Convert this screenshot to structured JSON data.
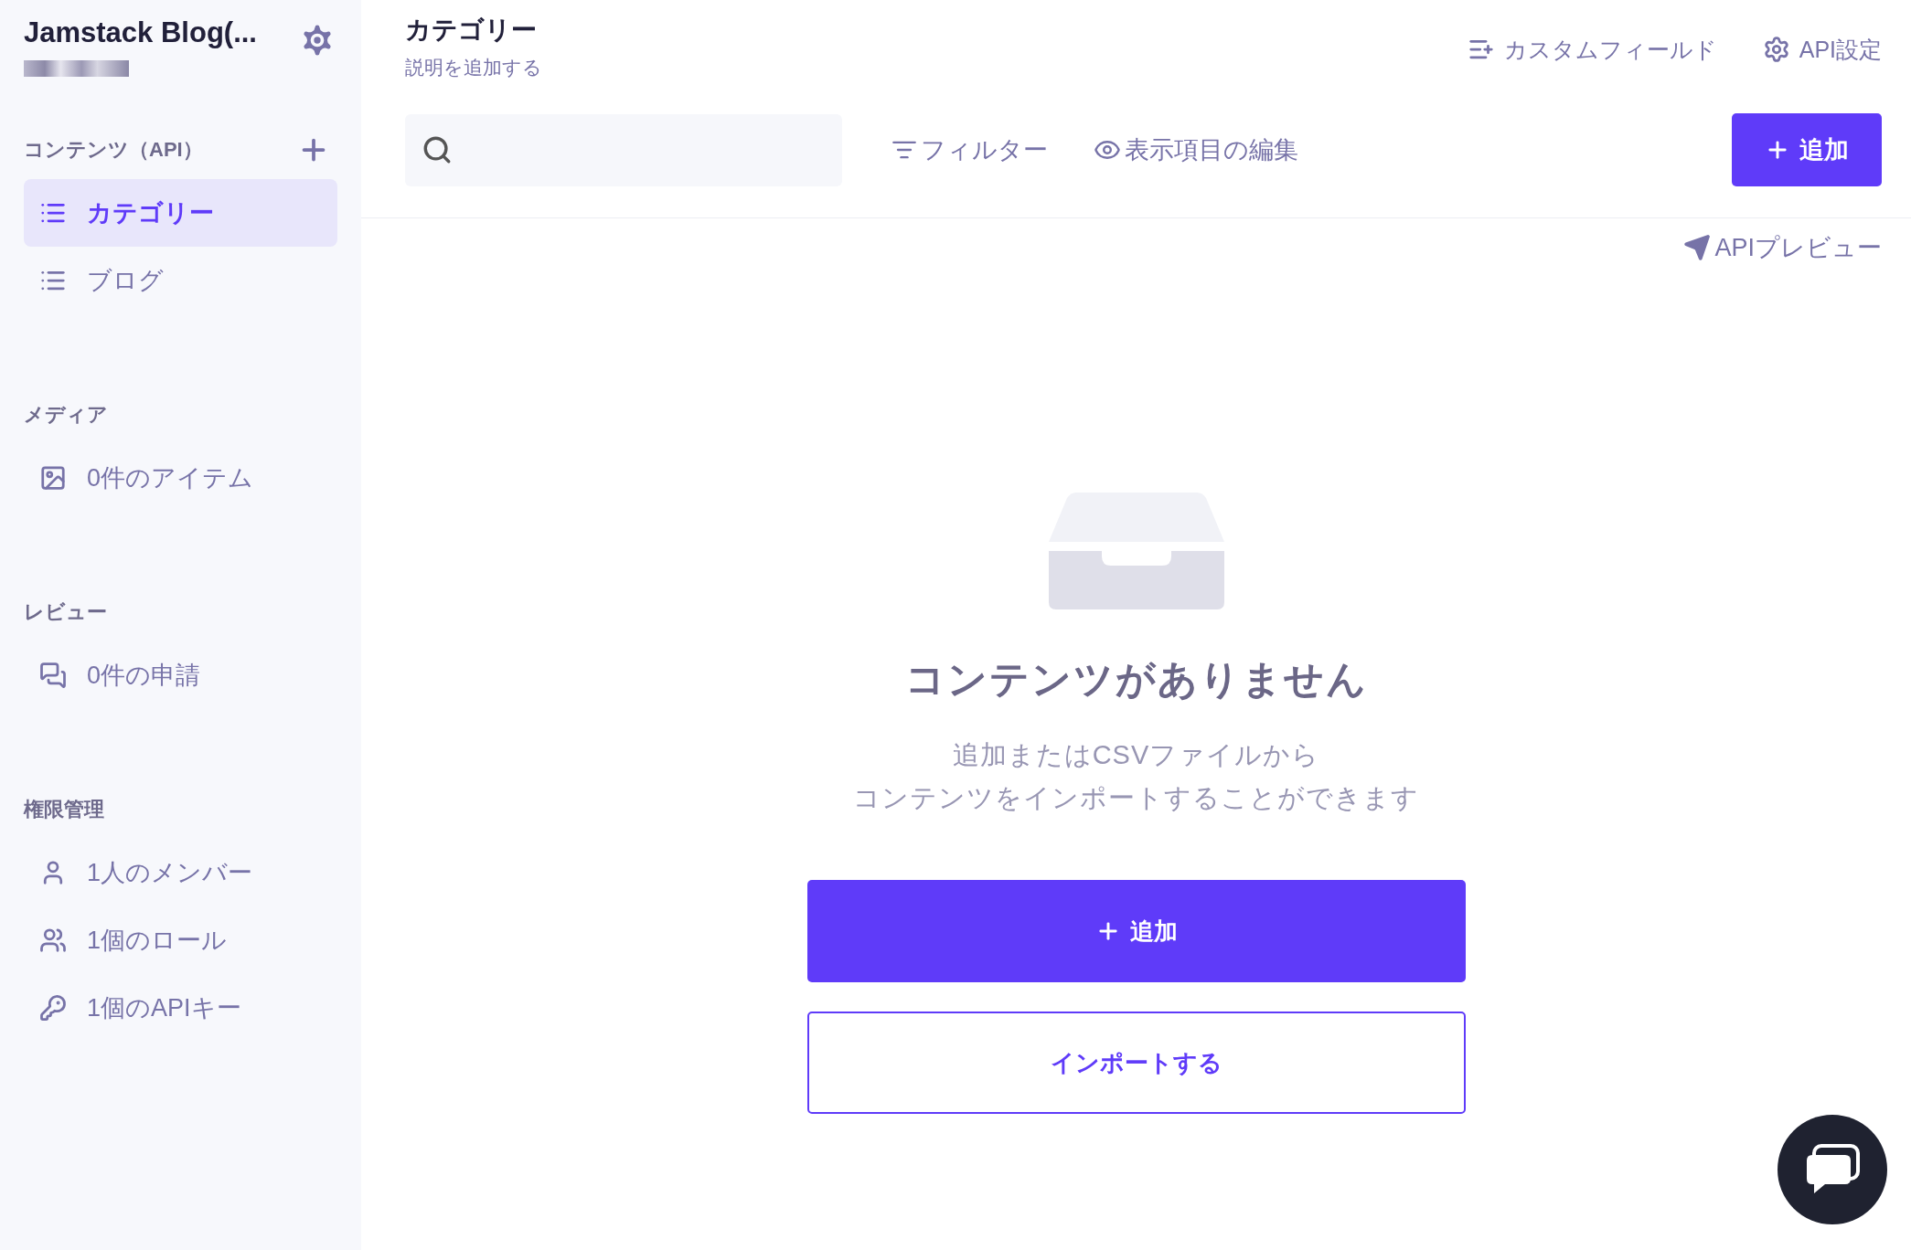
{
  "sidebar": {
    "project_title": "Jamstack Blog(...",
    "sections": [
      {
        "title": "コンテンツ（API）",
        "addable": true,
        "items": [
          {
            "label": "カテゴリー",
            "kind": "list",
            "selected": true
          },
          {
            "label": "ブログ",
            "kind": "list",
            "selected": false
          }
        ]
      },
      {
        "title": "メディア",
        "addable": false,
        "items": [
          {
            "label": "0件のアイテム",
            "kind": "image",
            "selected": false
          }
        ]
      },
      {
        "title": "レビュー",
        "addable": false,
        "items": [
          {
            "label": "0件の申請",
            "kind": "review",
            "selected": false
          }
        ]
      },
      {
        "title": "権限管理",
        "addable": false,
        "items": [
          {
            "label": "1人のメンバー",
            "kind": "person",
            "selected": false
          },
          {
            "label": "1個のロール",
            "kind": "group",
            "selected": false
          },
          {
            "label": "1個のAPIキー",
            "kind": "key",
            "selected": false
          }
        ]
      }
    ]
  },
  "header": {
    "title": "カテゴリー",
    "description": "説明を追加する",
    "actions": [
      {
        "kind": "custom-field",
        "label": "カスタムフィールド"
      },
      {
        "kind": "settings",
        "label": "API設定"
      }
    ]
  },
  "toolbar": {
    "filter": "フィルター",
    "columns": "表示項目の編集",
    "add": "追加"
  },
  "api_preview": "APIプレビュー",
  "empty_state": {
    "heading": "コンテンツがありません",
    "description_lines": [
      "追加またはCSVファイルから",
      "コンテンツをインポートすることができます"
    ],
    "add": "追加",
    "import": "インポートする"
  }
}
